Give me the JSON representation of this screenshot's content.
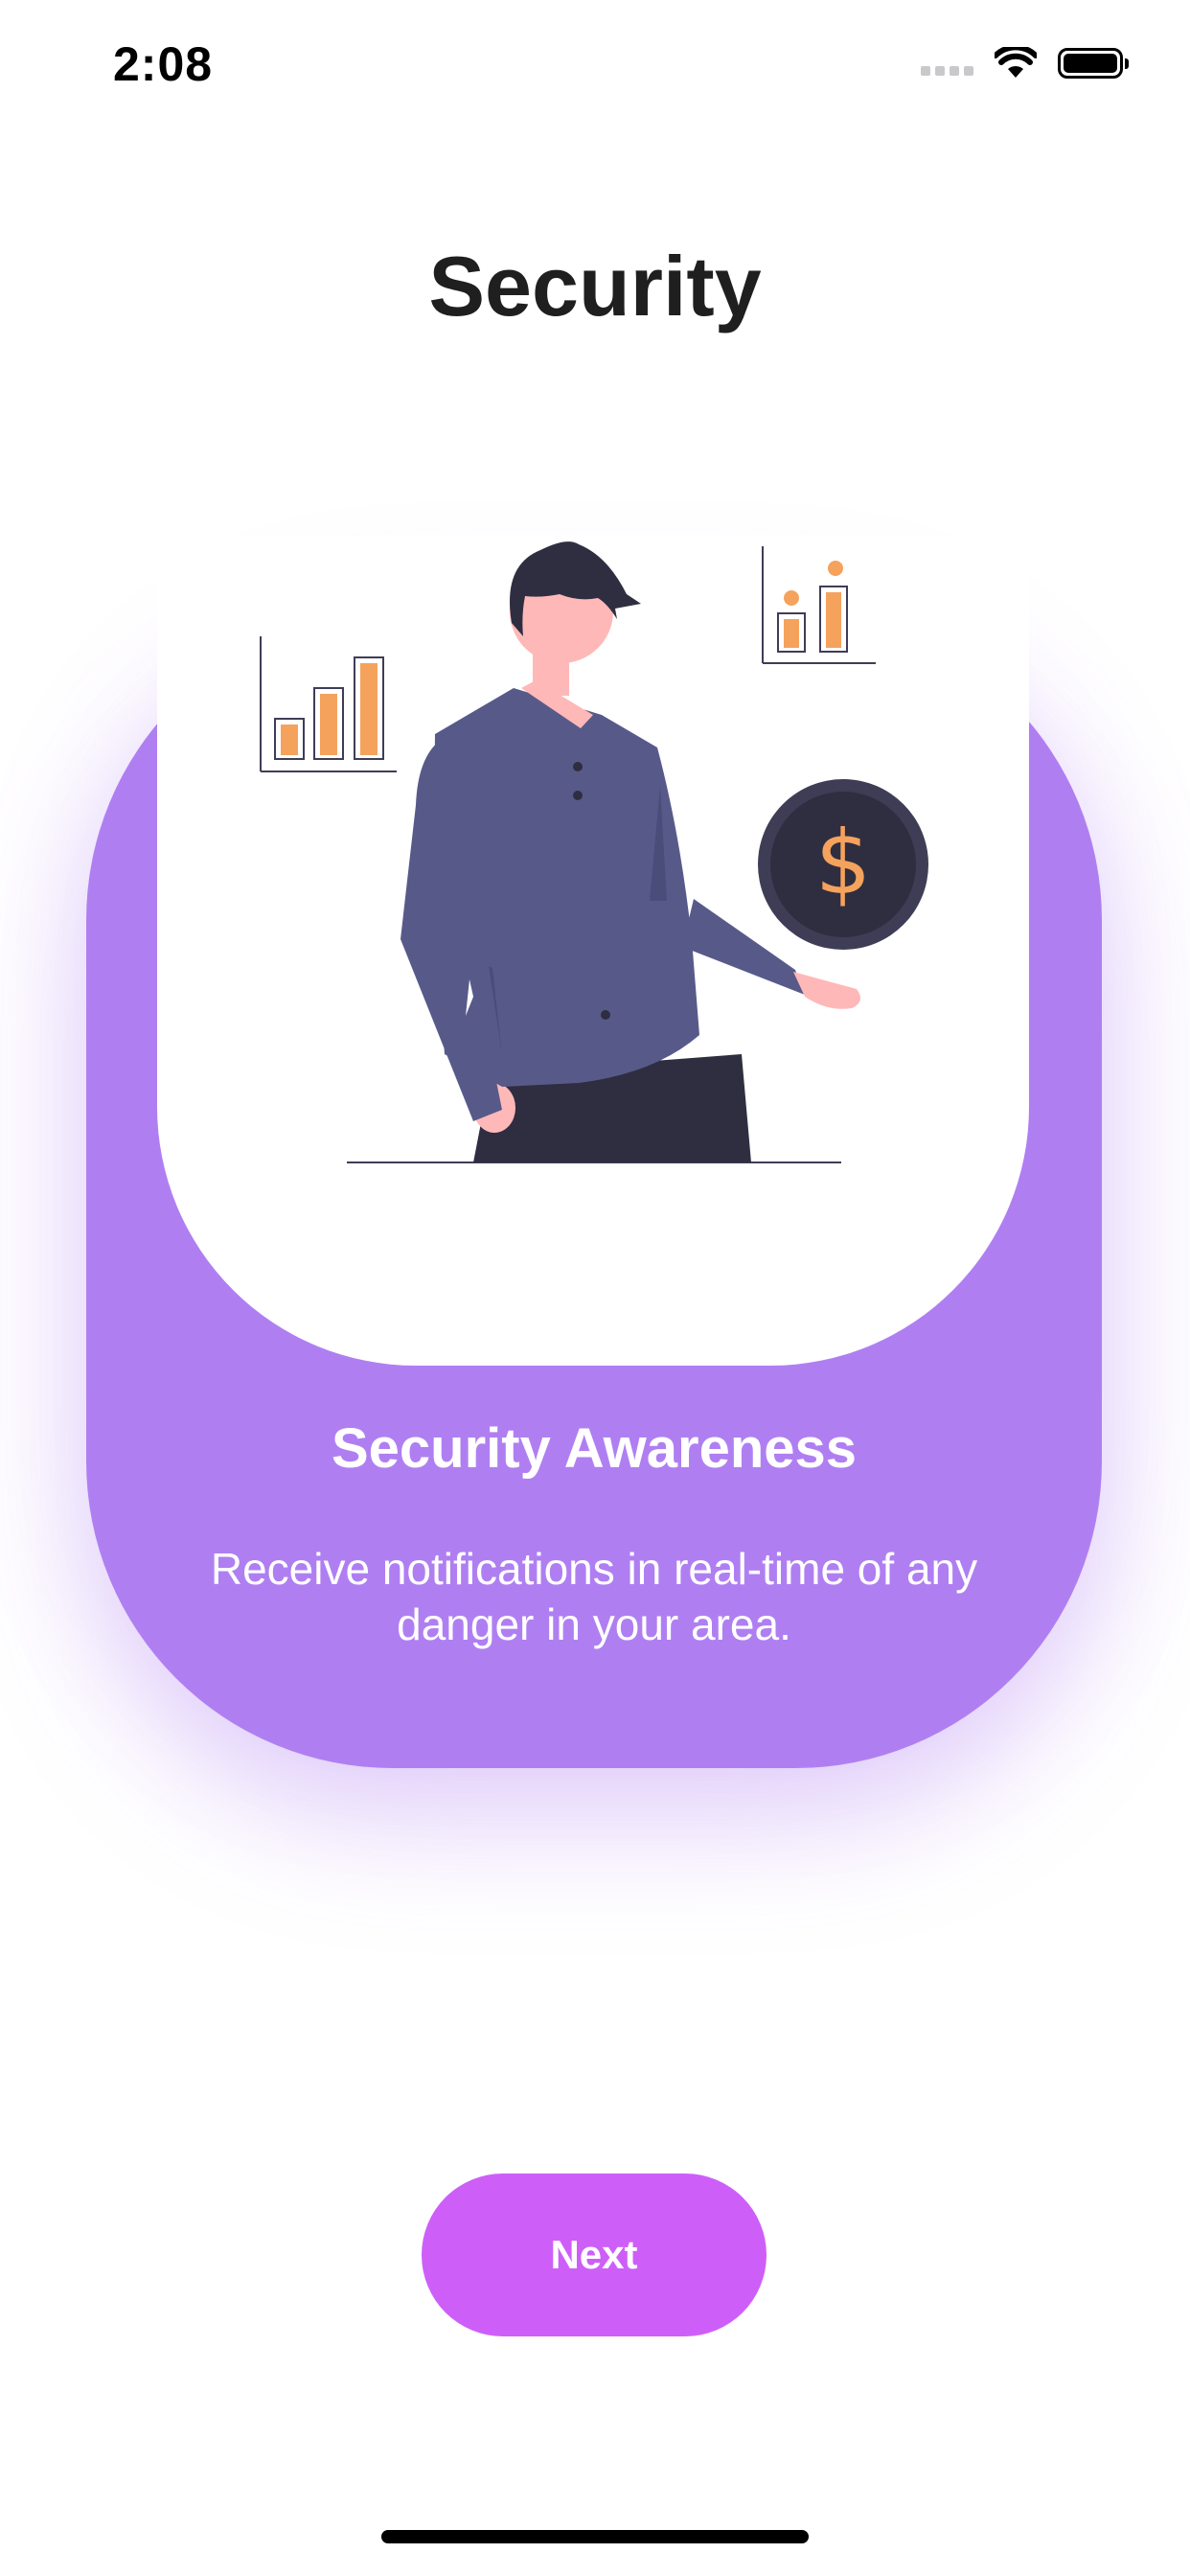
{
  "status_bar": {
    "time": "2:08"
  },
  "page": {
    "title": "Security"
  },
  "card": {
    "heading": "Security Awareness",
    "description": "Receive notifications in real-time of any danger in your area.",
    "illustration": {
      "coin_symbol": "$"
    }
  },
  "actions": {
    "next_label": "Next"
  },
  "colors": {
    "card_purple": "#af7ff2",
    "button_purple": "#cd5ff8",
    "accent_orange": "#f5a25d",
    "shirt": "#575a89",
    "dark": "#2f2e41",
    "skin": "#ffb8b8"
  }
}
